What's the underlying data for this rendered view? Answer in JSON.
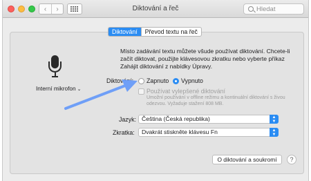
{
  "window": {
    "title": "Diktování a řeč"
  },
  "toolbar": {
    "back": "‹",
    "forward": "›",
    "search_placeholder": "Hledat"
  },
  "tabs": [
    {
      "label": "Diktování",
      "active": true
    },
    {
      "label": "Převod textu na řeč",
      "active": false
    }
  ],
  "microphone": {
    "label": "Interní mikrofon",
    "chevron": "⌄"
  },
  "description": "Místo zadávání textu můžete všude používat diktování. Chcete-li začít diktovat, použijte klávesovou zkratku nebo vyberte příkaz Zahájit diktování z nabídky Úpravy.",
  "dictation": {
    "label": "Diktování:",
    "on_label": "Zapnuto",
    "off_label": "Vypnuto",
    "selected": "off"
  },
  "enhanced": {
    "label": "Používat vylepšené diktování",
    "checked": false,
    "note": "Umožní používání v offline režimu a kontinuální diktování s živou odezvou. Vyžaduje stažení 808 MB."
  },
  "language": {
    "label": "Jazyk:",
    "value": "Čeština (Česká republika)"
  },
  "shortcut": {
    "label": "Zkratka:",
    "value": "Dvakrát stiskněte klávesu Fn"
  },
  "privacy_button": "O diktování a soukromí",
  "help_button": "?",
  "colors": {
    "accent": "#2a8cf3",
    "annotation_arrow": "#6f9ff7"
  }
}
